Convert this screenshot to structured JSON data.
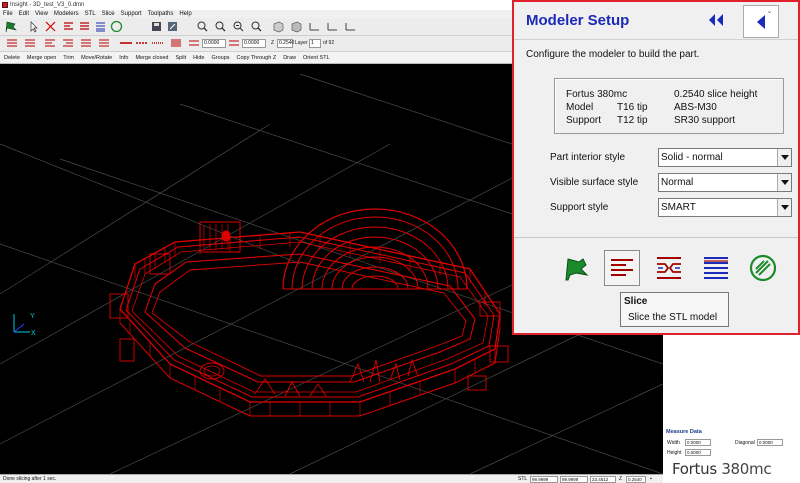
{
  "window": {
    "title": "Insight - 3D_test_V3_0.dmn"
  },
  "menu": [
    "File",
    "Edit",
    "View",
    "Modelers",
    "STL",
    "Slice",
    "Support",
    "Toolpaths",
    "Help"
  ],
  "toolbar2": {
    "field1": "0.0000",
    "field2": "0.0000",
    "z_label": "Z",
    "z_value": "0.2540",
    "layer_label": "Layer",
    "layer_value": "1",
    "of_label": "of 92"
  },
  "toolbar3": [
    "Delete",
    "Merge open",
    "Trim",
    "Move/Rotate",
    "Info",
    "Merge closed",
    "Split",
    "Hide",
    "Groups",
    "Copy Through Z",
    "Draw",
    "Orient STL"
  ],
  "viewport": {
    "axis_y": "Y",
    "axis_x": "X"
  },
  "panel": {
    "title": "Modeler Setup",
    "instructions": "Configure the modeler to build the part.",
    "info": {
      "modeler": "Fortus 380mc",
      "slice_height": "0.2540 slice height",
      "model_label": "Model",
      "model_tip": "T16 tip",
      "model_material": "ABS-M30",
      "support_label": "Support",
      "support_tip": "T12 tip",
      "support_material": "SR30 support"
    },
    "options": {
      "interior_label": "Part interior style",
      "interior_value": "Solid - normal",
      "surface_label": "Visible surface style",
      "surface_value": "Normal",
      "support_label": "Support style",
      "support_value": "SMART"
    },
    "tooltip": {
      "title": "Slice",
      "desc": "Slice the STL model"
    }
  },
  "measure": {
    "title": "Measure Data",
    "width_label": "Width",
    "width_value": "0.0000",
    "diagonal_label": "Diagonal",
    "diagonal_value": "0.0000",
    "height_label": "Height",
    "height_value": "0.0000"
  },
  "brand": {
    "name": "Fortus",
    "model": "380mc"
  },
  "status": {
    "message": "Done slicing after 1 sec.",
    "stl_label": "STL",
    "v1": "99.9999",
    "v2": "99.9999",
    "v3": "23.4512",
    "z_label": "Z",
    "z_value": "0.2540"
  },
  "colors": {
    "accent": "#e0202a",
    "title_blue": "#1b2ab8",
    "model_red": "#e00000",
    "icon_green": "#1a8a2a"
  }
}
